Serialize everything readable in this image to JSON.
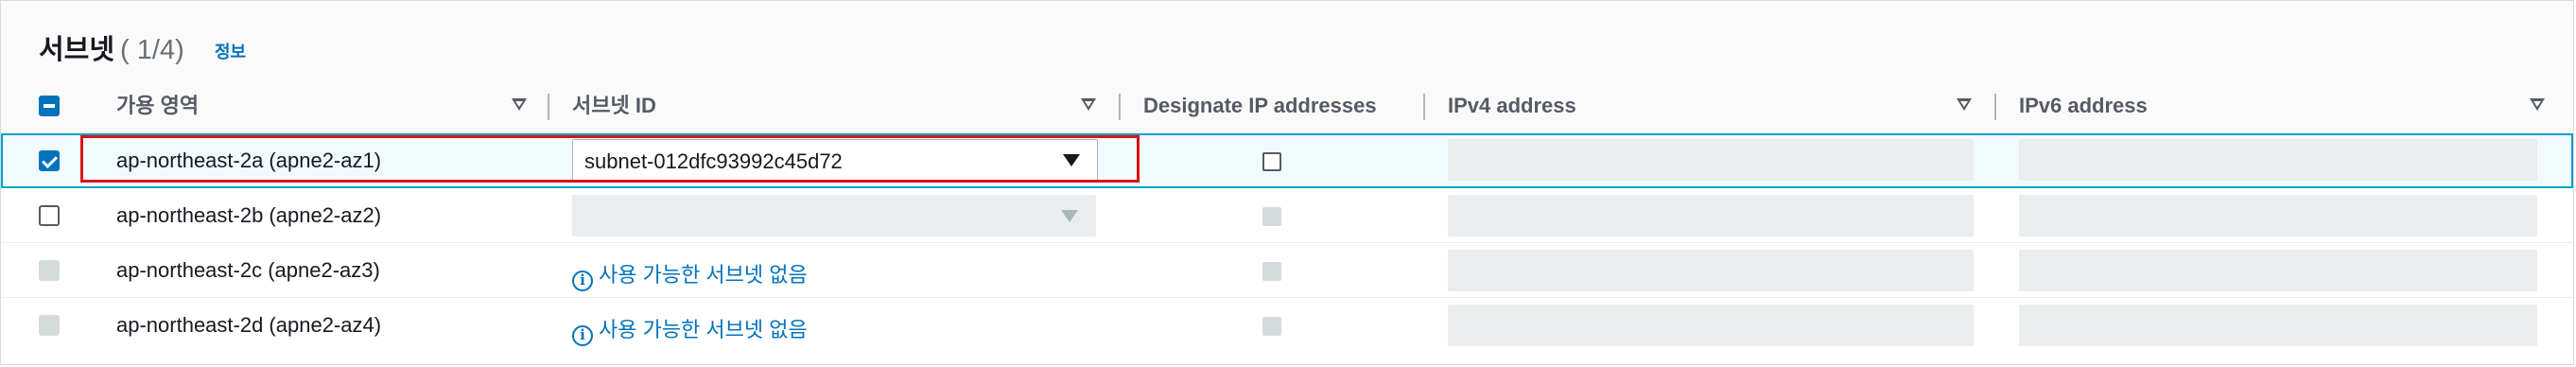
{
  "title": "서브넷",
  "count": "( 1/4)",
  "info_link": "정보",
  "columns": {
    "az": "가용 영역",
    "subnet_id": "서브넷 ID",
    "designate_ip": "Designate IP addresses",
    "ipv4": "IPv4 address",
    "ipv6": "IPv6 address"
  },
  "rows": [
    {
      "az": "ap-northeast-2a (apne2-az1)",
      "selected": true,
      "subnet": "subnet-012dfc93992c45d72"
    },
    {
      "az": "ap-northeast-2b (apne2-az2)",
      "selected": false,
      "subnet": ""
    },
    {
      "az": "ap-northeast-2c (apne2-az3)",
      "selected": false,
      "message": "사용 가능한 서브넷 없음"
    },
    {
      "az": "ap-northeast-2d (apne2-az4)",
      "selected": false,
      "message": "사용 가능한 서브넷 없음"
    }
  ],
  "colors": {
    "accent": "#0073bb",
    "highlight": "#d91515",
    "selected_row_bg": "#f1faff",
    "selected_row_border": "#00a1c9"
  },
  "icons": [
    "sort-caret-icon",
    "dropdown-caret-icon",
    "info-circle-icon",
    "checkbox-icon"
  ]
}
